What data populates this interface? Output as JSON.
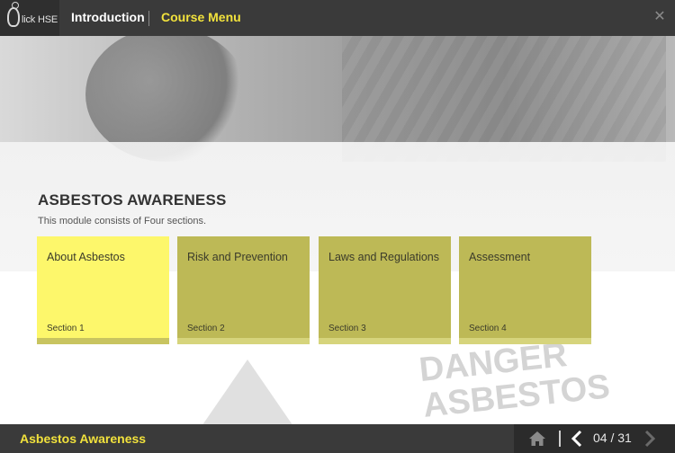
{
  "header": {
    "logo_text": "lick HSE",
    "intro_label": "Introduction",
    "menu_label": "Course Menu",
    "close_glyph": "✕"
  },
  "background": {
    "sign_text": "DANGER ASBESTOS"
  },
  "main": {
    "title": "ASBESTOS AWARENESS",
    "subtitle": "This module consists of Four sections.",
    "sections": [
      {
        "title": "About Asbestos",
        "label": "Section 1"
      },
      {
        "title": "Risk and Prevention",
        "label": "Section 2"
      },
      {
        "title": "Laws and Regulations",
        "label": "Section 3"
      },
      {
        "title": "Assessment",
        "label": "Section 4"
      }
    ]
  },
  "footer": {
    "course_title": "Asbestos Awareness",
    "page_counter": "04 / 31"
  },
  "colors": {
    "accent_yellow": "#f2e23c",
    "card_active": "#fdf76b",
    "card_inactive": "#bdb956",
    "bar_dark": "#3a3a3a"
  }
}
